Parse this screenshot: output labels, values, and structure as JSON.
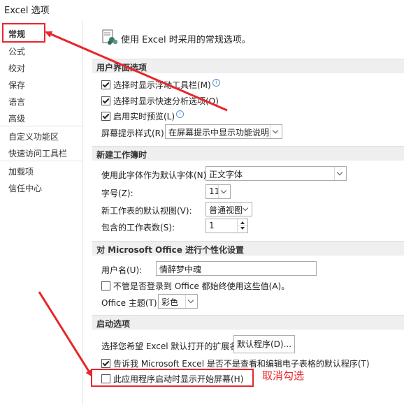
{
  "window": {
    "title": "Excel 选项"
  },
  "sidebar": {
    "items": [
      {
        "label": "常规"
      },
      {
        "label": "公式"
      },
      {
        "label": "校对"
      },
      {
        "label": "保存"
      },
      {
        "label": "语言"
      },
      {
        "label": "高级"
      },
      {
        "label": "自定义功能区"
      },
      {
        "label": "快速访问工具栏"
      },
      {
        "label": "加载项"
      },
      {
        "label": "信任中心"
      }
    ]
  },
  "header": {
    "text": "使用 Excel 时采用的常规选项。"
  },
  "sections": {
    "ui": {
      "title": "用户界面选项",
      "mini_toolbar": "选择时显示浮动工具栏(M)",
      "quick_analysis": "选择时显示快速分析选项(Q)",
      "live_preview": "启用实时预览(L)",
      "tip_style_label": "屏幕提示样式(R):",
      "tip_style_value": "在屏幕提示中显示功能说明"
    },
    "new_workbook": {
      "title": "新建工作簿时",
      "font_label": "使用此字体作为默认字体(N):",
      "font_value": "正文字体",
      "size_label": "字号(Z):",
      "size_value": "11",
      "view_label": "新工作表的默认视图(V):",
      "view_value": "普通视图",
      "sheets_label": "包含的工作表数(S):",
      "sheets_value": "1"
    },
    "personalize": {
      "title": "对 Microsoft Office 进行个性化设置",
      "user_label": "用户名(U):",
      "user_value": "情醉梦中魂",
      "always_use": "不管是否登录到 Office 都始终使用这些值(A)。",
      "theme_label": "Office 主题(T):",
      "theme_value": "彩色"
    },
    "startup": {
      "title": "启动选项",
      "ext_label": "选择您希望 Excel 默认打开的扩展名:",
      "default_programs_button": "默认程序(D)...",
      "tell_me": "告诉我 Microsoft Excel 是否不是查看和编辑电子表格的默认程序(T)",
      "show_start_screen": "此应用程序启动时显示开始屏幕(H)"
    }
  },
  "checkbox_states": {
    "mini_toolbar": true,
    "quick_analysis": true,
    "live_preview": true,
    "always_use": false,
    "tell_me": true,
    "show_start_screen": false
  },
  "annotation": {
    "text": "取消勾选",
    "color": "#e8262b"
  }
}
